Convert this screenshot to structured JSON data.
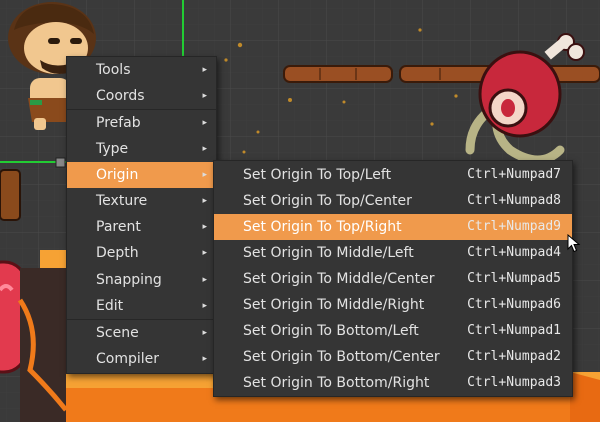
{
  "colors": {
    "canvas_bg": "#3a3a3a",
    "grid_line": "#4a4a4a",
    "menu_bg": "#353535",
    "menu_highlight": "#f09a4c",
    "menu_text": "#e2e2e2",
    "guide_green": "#22cc33",
    "lava_orange": "#f07a1a",
    "meat_red": "#c8283c"
  },
  "main_menu": {
    "items": [
      {
        "label": "Tools",
        "icon": "submenu-arrow-icon"
      },
      {
        "label": "Coords",
        "icon": "submenu-arrow-icon"
      },
      {
        "label": "Prefab",
        "icon": "submenu-arrow-icon"
      },
      {
        "label": "Type",
        "icon": "submenu-arrow-icon"
      },
      {
        "label": "Origin",
        "icon": "submenu-arrow-icon",
        "active": true
      },
      {
        "label": "Texture",
        "icon": "submenu-arrow-icon"
      },
      {
        "label": "Parent",
        "icon": "submenu-arrow-icon"
      },
      {
        "label": "Depth",
        "icon": "submenu-arrow-icon"
      },
      {
        "label": "Snapping",
        "icon": "submenu-arrow-icon"
      },
      {
        "label": "Edit",
        "icon": "submenu-arrow-icon"
      },
      {
        "label": "Scene",
        "icon": "submenu-arrow-icon"
      },
      {
        "label": "Compiler",
        "icon": "submenu-arrow-icon"
      }
    ]
  },
  "origin_submenu": {
    "items": [
      {
        "label": "Set Origin To Top/Left",
        "shortcut": "Ctrl+Numpad7"
      },
      {
        "label": "Set Origin To Top/Center",
        "shortcut": "Ctrl+Numpad8"
      },
      {
        "label": "Set Origin To Top/Right",
        "shortcut": "Ctrl+Numpad9",
        "active": true
      },
      {
        "label": "Set Origin To Middle/Left",
        "shortcut": "Ctrl+Numpad4"
      },
      {
        "label": "Set Origin To Middle/Center",
        "shortcut": "Ctrl+Numpad5"
      },
      {
        "label": "Set Origin To Middle/Right",
        "shortcut": "Ctrl+Numpad6"
      },
      {
        "label": "Set Origin To Bottom/Left",
        "shortcut": "Ctrl+Numpad1"
      },
      {
        "label": "Set Origin To Bottom/Center",
        "shortcut": "Ctrl+Numpad2"
      },
      {
        "label": "Set Origin To Bottom/Right",
        "shortcut": "Ctrl+Numpad3"
      }
    ]
  },
  "icons": {
    "submenu_arrow": "▸",
    "mouse_cursor": "mouse-pointer-icon"
  }
}
